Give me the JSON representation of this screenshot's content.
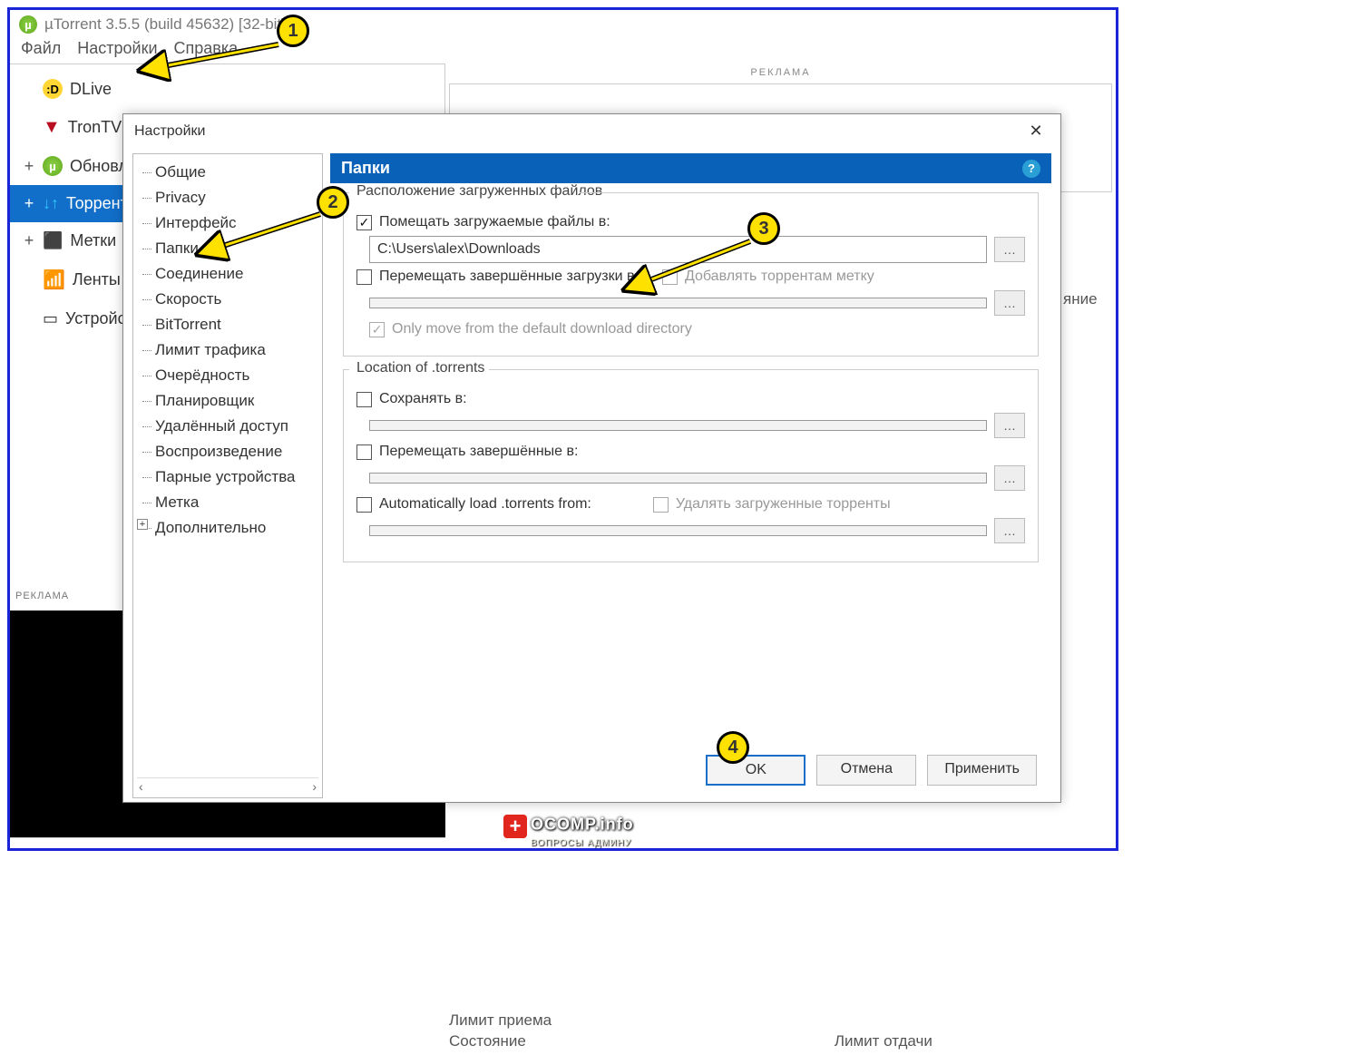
{
  "app": {
    "title": "µTorrent 3.5.5  (build 45632) [32-bit]"
  },
  "menubar": [
    "Файл",
    "Настройки",
    "Справка"
  ],
  "sidebar": {
    "items": [
      {
        "label": "DLive",
        "icon": "dlive",
        "expander": ""
      },
      {
        "label": "TronTV",
        "icon": "tron",
        "expander": ""
      },
      {
        "label": "Обновление",
        "icon": "u",
        "expander": "+"
      },
      {
        "label": "Торренты",
        "icon": "arrows",
        "expander": "+",
        "selected": true
      },
      {
        "label": "Метки",
        "icon": "labels",
        "expander": "+"
      },
      {
        "label": "Ленты",
        "icon": "feed",
        "expander": ""
      },
      {
        "label": "Устройства",
        "icon": "dev",
        "expander": ""
      }
    ]
  },
  "ads_label": "РЕКЛАМА",
  "right_cut_text": "яние",
  "bottom": {
    "line1": "Лимит приема",
    "line2": "Состояние",
    "right": "Лимит отдачи"
  },
  "dialog": {
    "title": "Настройки",
    "tree": [
      "Общие",
      "Privacy",
      "Интерфейс",
      "Папки",
      "Соединение",
      "Скорость",
      "BitTorrent",
      "Лимит трафика",
      "Очерёдность",
      "Планировщик",
      "Удалённый доступ",
      "Воспроизведение",
      "Парные устройства",
      "Метка",
      "Дополнительно"
    ],
    "tree_selected": "Папки",
    "panel_title": "Папки",
    "group1": {
      "legend": "Расположение загруженных файлов",
      "opt1_label": "Помещать загружаемые файлы в:",
      "opt1_path": "C:\\Users\\alex\\Downloads",
      "opt2_label": "Перемещать завершённые загрузки в:",
      "opt2_side": "Добавлять торрентам метку",
      "opt3_label": "Only move from the default download directory"
    },
    "group2": {
      "legend": "Location of .torrents",
      "opt1_label": "Сохранять в:",
      "opt2_label": "Перемещать завершённые в:",
      "opt3_label": "Automatically load .torrents from:",
      "opt3_side": "Удалять загруженные торренты"
    },
    "buttons": {
      "ok": "OK",
      "cancel": "Отмена",
      "apply": "Применить"
    }
  },
  "callouts": {
    "c1": "1",
    "c2": "2",
    "c3": "3",
    "c4": "4"
  },
  "watermark": {
    "brand": "OCOMP.info",
    "sub": "ВОПРОСЫ АДМИНУ"
  }
}
